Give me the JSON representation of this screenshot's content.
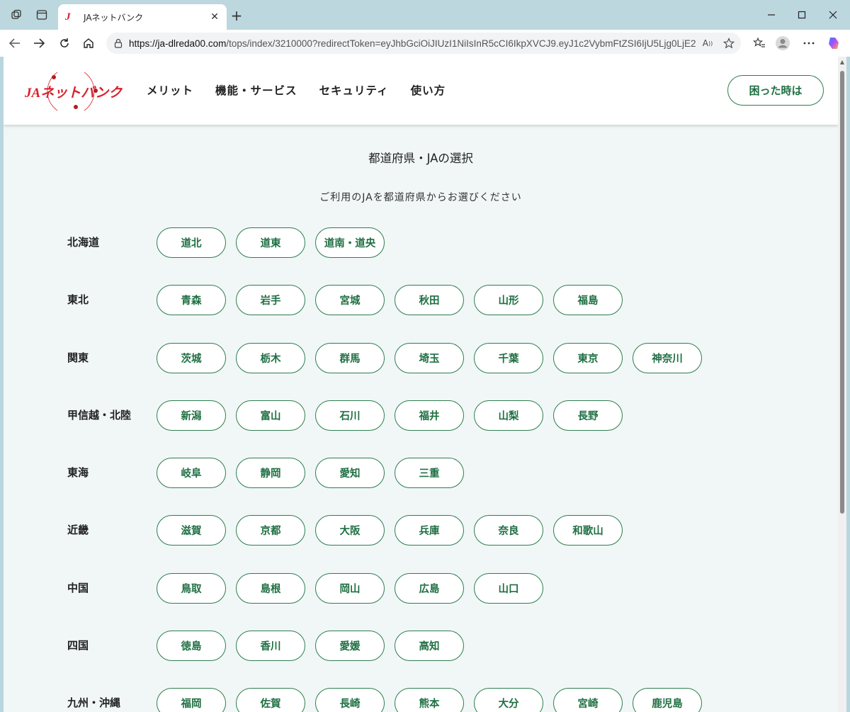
{
  "browser": {
    "tab_title": "JAネットバンク",
    "tab_favicon": "J",
    "url_host": "https://ja-dlreda00.com",
    "url_rest": "/tops/index/3210000?redirectToken=eyJhbGciOiJIUzI1NiIsInR5cCI6IkpXVCJ9.eyJ1c2VybmFtZSI6IjU5Ljg0LjE2..."
  },
  "icons": {
    "workspaces": "workspaces-icon",
    "tab_actions": "tab-actions-icon",
    "back": "back-arrow-icon",
    "forward": "forward-arrow-icon",
    "refresh": "refresh-icon",
    "home": "home-icon",
    "lock": "lock-icon",
    "read_aloud": "read-aloud-icon",
    "favorite": "star-icon",
    "favorites": "favorites-icon",
    "profile": "profile-icon",
    "copilot": "copilot-icon"
  },
  "header": {
    "logo_text": "JAネットバンク",
    "nav": [
      "メリット",
      "機能・サービス",
      "セキュリティ",
      "使い方"
    ],
    "help_button": "困った時は"
  },
  "main": {
    "title": "都道府県・JAの選択",
    "subtitle": "ご利用のJAを都道府県からお選びください",
    "regions": [
      {
        "label": "北海道",
        "prefectures": [
          "道北",
          "道東",
          "道南・道央"
        ]
      },
      {
        "label": "東北",
        "prefectures": [
          "青森",
          "岩手",
          "宮城",
          "秋田",
          "山形",
          "福島"
        ]
      },
      {
        "label": "関東",
        "prefectures": [
          "茨城",
          "栃木",
          "群馬",
          "埼玉",
          "千葉",
          "東京",
          "神奈川"
        ]
      },
      {
        "label": "甲信越・北陸",
        "prefectures": [
          "新潟",
          "富山",
          "石川",
          "福井",
          "山梨",
          "長野"
        ]
      },
      {
        "label": "東海",
        "prefectures": [
          "岐阜",
          "静岡",
          "愛知",
          "三重"
        ]
      },
      {
        "label": "近畿",
        "prefectures": [
          "滋賀",
          "京都",
          "大阪",
          "兵庫",
          "奈良",
          "和歌山"
        ]
      },
      {
        "label": "中国",
        "prefectures": [
          "鳥取",
          "島根",
          "岡山",
          "広島",
          "山口"
        ]
      },
      {
        "label": "四国",
        "prefectures": [
          "徳島",
          "香川",
          "愛媛",
          "高知"
        ]
      },
      {
        "label": "九州・沖縄",
        "prefectures": [
          "福岡",
          "佐賀",
          "長崎",
          "熊本",
          "大分",
          "宮崎",
          "鹿児島"
        ]
      }
    ]
  },
  "colors": {
    "accent_green": "#1f6f43",
    "border_green": "#2e7d4f",
    "logo_red": "#d8202a",
    "page_bg": "#f0f7f6",
    "chrome_bg": "#bcd7de"
  }
}
